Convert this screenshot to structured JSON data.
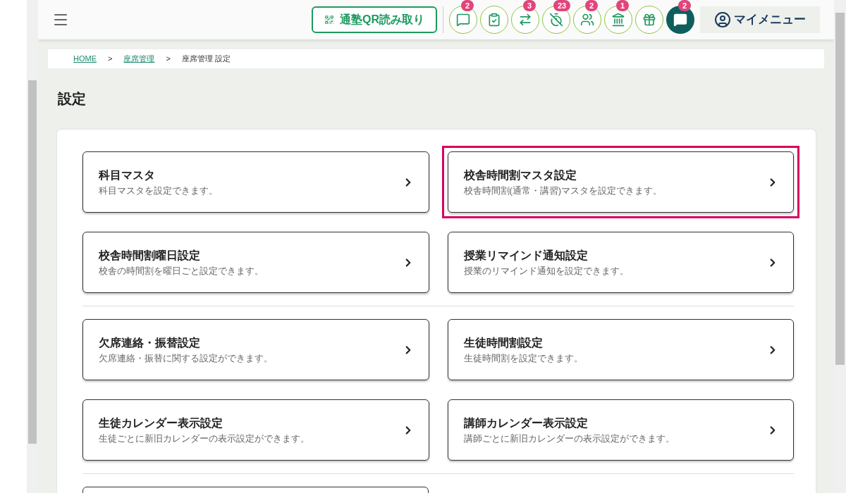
{
  "header": {
    "qr_button": "通塾QR読み取り",
    "icons": [
      {
        "kind": "chat",
        "badge": "2",
        "selected": false
      },
      {
        "kind": "checklist",
        "selected": false
      },
      {
        "kind": "exchange",
        "badge": "3",
        "selected": false
      },
      {
        "kind": "timer-off",
        "badge": "23",
        "selected": false
      },
      {
        "kind": "group",
        "badge": "2",
        "selected": false
      },
      {
        "kind": "school",
        "badge": "1",
        "selected": false
      },
      {
        "kind": "gift",
        "selected": false
      },
      {
        "kind": "chat",
        "badge": "2",
        "selected": true
      }
    ],
    "my_menu": "マイメニュー"
  },
  "breadcrumb": [
    {
      "label": "HOME",
      "link": true
    },
    {
      "label": ">",
      "link": false
    },
    {
      "label": "座席管理",
      "link": true
    },
    {
      "label": ">",
      "link": false
    },
    {
      "label": "座席管理 設定",
      "link": false
    }
  ],
  "title": "設定",
  "sections": [
    [
      {
        "title": "科目マスタ",
        "description": "科目マスタを設定できます。",
        "highlighted": false
      },
      {
        "title": "校舎時間割マスタ設定",
        "description": "校舎時間割(通常・講習)マスタを設定できます。",
        "highlighted": true
      },
      {
        "title": "校舎時間割曜日設定",
        "description": "校舎の時間割を曜日ごと設定できます。",
        "highlighted": false
      },
      {
        "title": "授業リマインド通知設定",
        "description": "授業のリマインド通知を設定できます。",
        "highlighted": false
      }
    ],
    [
      {
        "title": "欠席連絡・振替設定",
        "description": "欠席連絡・振替に関する設定ができます。",
        "highlighted": false
      },
      {
        "title": "生徒時間割設定",
        "description": "生徒時間割を設定できます。",
        "highlighted": false
      },
      {
        "title": "生徒カレンダー表示設定",
        "description": "生徒ごとに新旧カレンダーの表示設定ができます。",
        "highlighted": false
      },
      {
        "title": "講師カレンダー表示設定",
        "description": "講師ごとに新旧カレンダーの表示設定ができます。",
        "highlighted": false
      }
    ]
  ]
}
